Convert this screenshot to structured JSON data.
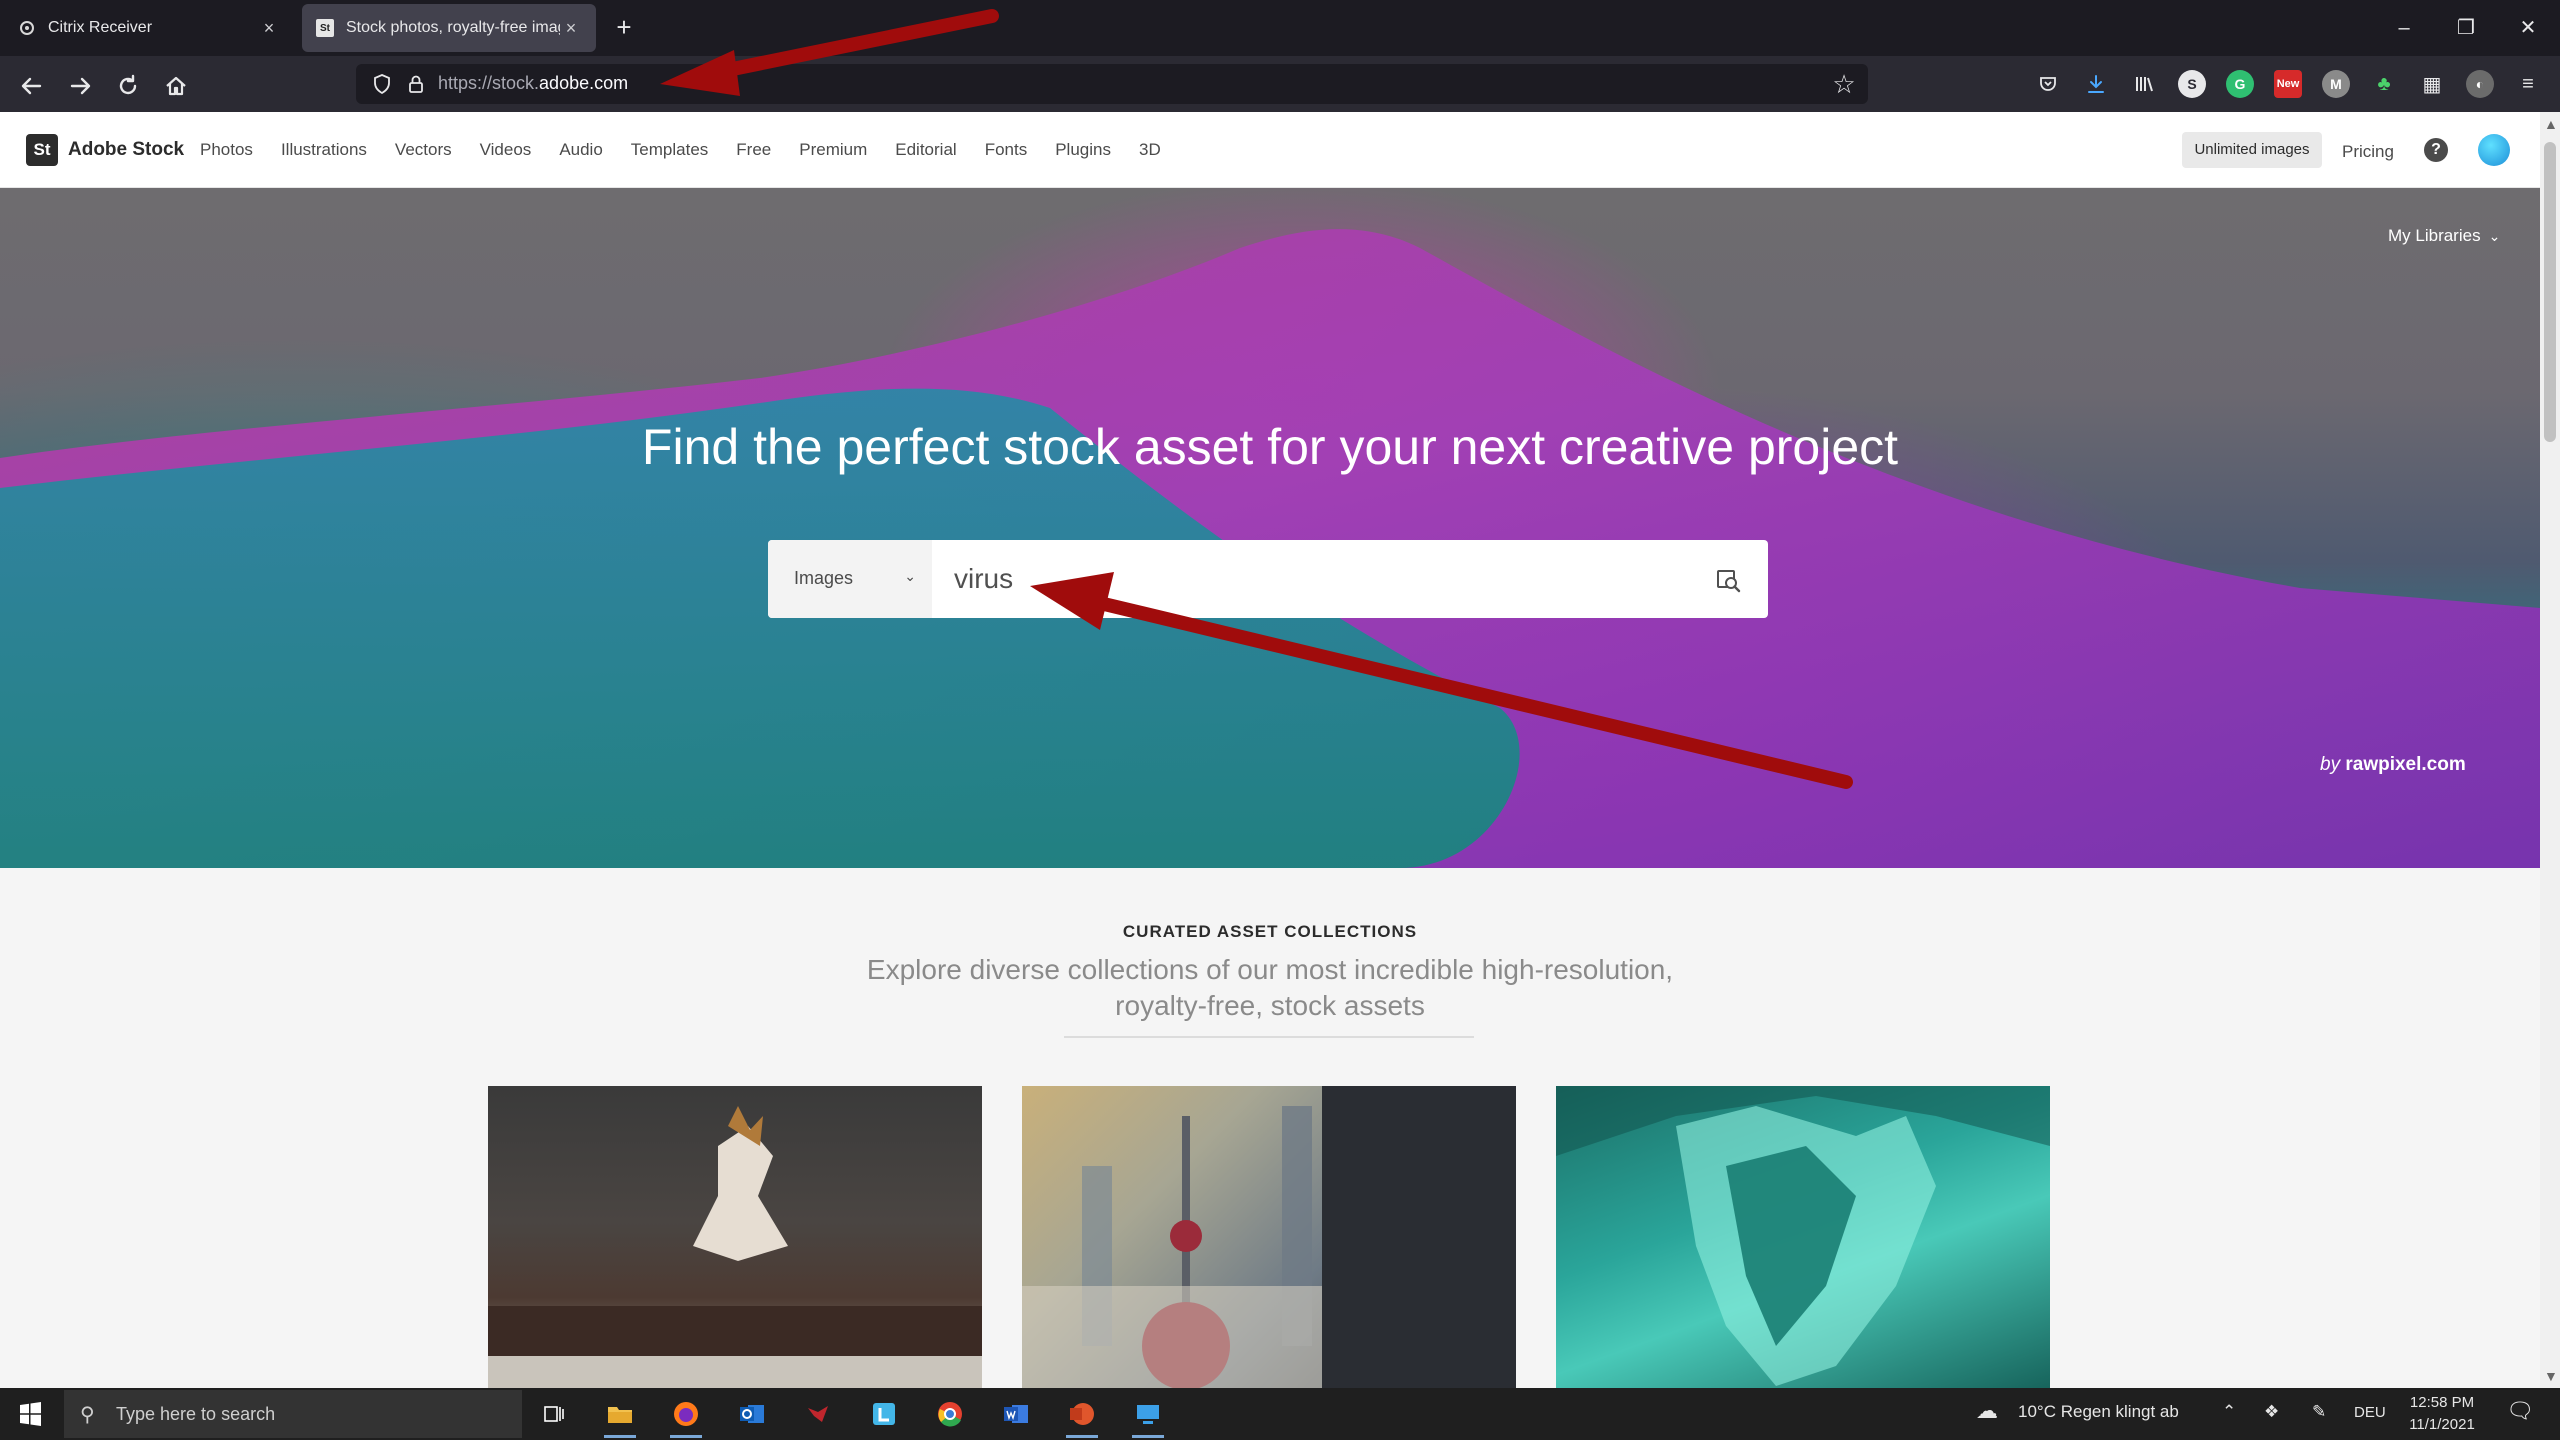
{
  "browser": {
    "tabs": [
      {
        "title": "Citrix Receiver",
        "active": false
      },
      {
        "title": "Stock photos, royalty-free imag",
        "active": true
      }
    ],
    "new_tab": "+",
    "url_prefix": "https://stock.",
    "url_domain": "adobe.com",
    "window_controls": [
      "–",
      "❐",
      "✕"
    ],
    "nav_icons": [
      "back-icon",
      "forward-icon",
      "reload-icon",
      "home-icon"
    ]
  },
  "site": {
    "logo_mark": "St",
    "logo_name": "Adobe Stock",
    "menu": [
      "Photos",
      "Illustrations",
      "Vectors",
      "Videos",
      "Audio",
      "Templates",
      "Free",
      "Premium",
      "Editorial",
      "Fonts",
      "Plugins",
      "3D"
    ],
    "unlimited_label": "Unlimited images",
    "pricing_label": "Pricing",
    "help_label": "?"
  },
  "hero": {
    "my_libraries": "My Libraries",
    "title": "Find the perfect stock asset for your next creative project",
    "search_type": "Images",
    "search_value": "virus",
    "credit_by": "by",
    "credit_name": "rawpixel.com"
  },
  "collections": {
    "heading": "CURATED ASSET COLLECTIONS",
    "subtitle_line1": "Explore diverse collections of our most incredible high-resolution,",
    "subtitle_line2": "royalty-free, stock assets"
  },
  "taskbar": {
    "search_placeholder": "Type here to search",
    "weather": "10°C  Regen klingt ab",
    "language": "DEU",
    "time": "12:58 PM",
    "date": "11/1/2021"
  },
  "colors": {
    "annotation_arrow": "#a00c0c",
    "browser_bg": "#1c1b22",
    "toolbar_bg": "#2b2a33"
  }
}
